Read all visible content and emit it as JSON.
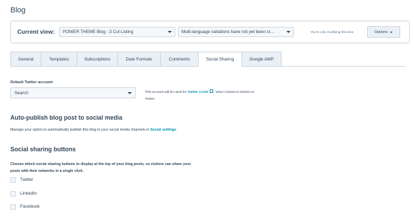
{
  "page": {
    "title": "Blog"
  },
  "current_view": {
    "label": "Current view:",
    "theme_select": "POWER THEME Blog - 3 Col Listing",
    "language_select": "Multi-language variations have not yet been cr...",
    "modify_note": "You're only modifying this view.",
    "options_label": "Options"
  },
  "tabs": [
    {
      "label": "General"
    },
    {
      "label": "Templates"
    },
    {
      "label": "Subscriptions"
    },
    {
      "label": "Date Formats"
    },
    {
      "label": "Comments"
    },
    {
      "label": "Social Sharing"
    },
    {
      "label": "Google AMP"
    }
  ],
  "twitter": {
    "label": "Default Twitter account",
    "select_value": "Search",
    "help_prefix": "This account will be used for",
    "help_link": "Twitter Cards",
    "help_suffix": "when content is shared on",
    "help_line2": "Twitter"
  },
  "auto_publish": {
    "title": "Auto-publish blog post to social media",
    "text": "Manage your option to automatically publish this blog to your social media channels in",
    "link": "Social settings",
    "suffix": "."
  },
  "social_buttons": {
    "title": "Social sharing buttons",
    "text": "Choose which social sharing buttons to display at the top of your blog posts, so visitors can share your posts with their networks in a single click.",
    "options": [
      {
        "label": "Twitter"
      },
      {
        "label": "Linkedin"
      },
      {
        "label": "Facebook"
      }
    ]
  },
  "colors": {
    "text": "#33475b",
    "link": "#0091ae",
    "border": "#cbd6e2",
    "tab_bg": "#eaf0f6"
  },
  "icons": [
    "caret-down-icon",
    "external-link-icon",
    "checkbox-icon"
  ]
}
